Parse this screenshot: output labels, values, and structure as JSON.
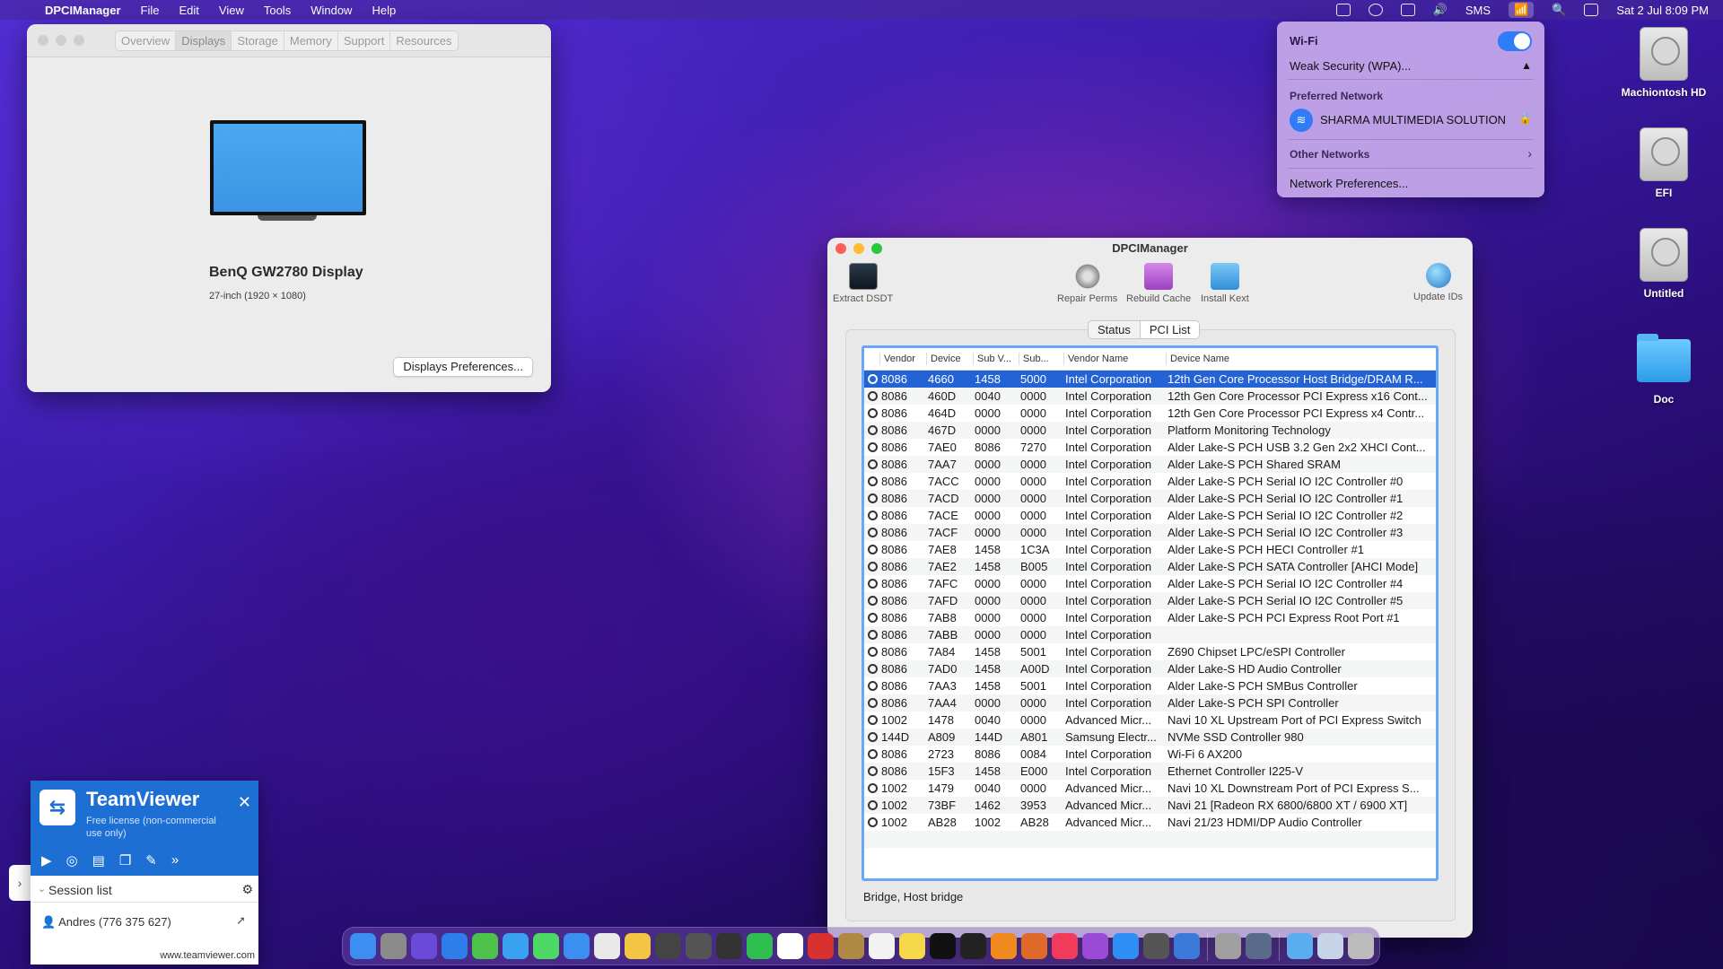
{
  "menubar": {
    "app": "DPCIManager",
    "items": [
      "File",
      "Edit",
      "View",
      "Tools",
      "Window",
      "Help"
    ],
    "sms": "SMS",
    "datetime": "Sat 2 Jul  8:09 PM"
  },
  "about": {
    "tabs": [
      "Overview",
      "Displays",
      "Storage",
      "Memory",
      "Support",
      "Resources"
    ],
    "display_name": "BenQ GW2780 Display",
    "display_sub": "27-inch (1920 × 1080)",
    "prefs_button": "Displays Preferences..."
  },
  "wifi_menu": {
    "title": "Wi-Fi",
    "weak": "Weak Security (WPA)...",
    "preferred_header": "Preferred Network",
    "network": "SHARMA MULTIMEDIA SOLUTION",
    "other": "Other Networks",
    "prefs": "Network Preferences..."
  },
  "desktop": [
    {
      "label": "Machiontosh HD",
      "icon": "hdd-icon"
    },
    {
      "label": "EFI",
      "icon": "hdd-icon"
    },
    {
      "label": "Untitled",
      "icon": "hdd-icon"
    },
    {
      "label": "Doc",
      "icon": "folder-icon"
    }
  ],
  "dpci": {
    "title": "DPCIManager",
    "tools": {
      "extract": "Extract DSDT",
      "repair": "Repair Perms",
      "rebuild": "Rebuild Cache",
      "install": "Install Kext",
      "update": "Update IDs"
    },
    "segments": [
      "Status",
      "PCI List"
    ],
    "columns": [
      "Vendor",
      "Device",
      "Sub V...",
      "Sub...",
      "Vendor Name",
      "Device Name"
    ],
    "rows": [
      [
        "8086",
        "4660",
        "1458",
        "5000",
        "Intel Corporation",
        "12th Gen Core Processor Host Bridge/DRAM R..."
      ],
      [
        "8086",
        "460D",
        "0040",
        "0000",
        "Intel Corporation",
        "12th Gen Core Processor PCI Express x16 Cont..."
      ],
      [
        "8086",
        "464D",
        "0000",
        "0000",
        "Intel Corporation",
        "12th Gen Core Processor PCI Express x4 Contr..."
      ],
      [
        "8086",
        "467D",
        "0000",
        "0000",
        "Intel Corporation",
        "Platform Monitoring Technology"
      ],
      [
        "8086",
        "7AE0",
        "8086",
        "7270",
        "Intel Corporation",
        "Alder Lake-S PCH USB 3.2 Gen 2x2 XHCI Cont..."
      ],
      [
        "8086",
        "7AA7",
        "0000",
        "0000",
        "Intel Corporation",
        "Alder Lake-S PCH Shared SRAM"
      ],
      [
        "8086",
        "7ACC",
        "0000",
        "0000",
        "Intel Corporation",
        "Alder Lake-S PCH Serial IO I2C Controller #0"
      ],
      [
        "8086",
        "7ACD",
        "0000",
        "0000",
        "Intel Corporation",
        "Alder Lake-S PCH Serial IO I2C Controller #1"
      ],
      [
        "8086",
        "7ACE",
        "0000",
        "0000",
        "Intel Corporation",
        "Alder Lake-S PCH Serial IO I2C Controller #2"
      ],
      [
        "8086",
        "7ACF",
        "0000",
        "0000",
        "Intel Corporation",
        "Alder Lake-S PCH Serial IO I2C Controller #3"
      ],
      [
        "8086",
        "7AE8",
        "1458",
        "1C3A",
        "Intel Corporation",
        "Alder Lake-S PCH HECI Controller #1"
      ],
      [
        "8086",
        "7AE2",
        "1458",
        "B005",
        "Intel Corporation",
        "Alder Lake-S PCH SATA Controller [AHCI Mode]"
      ],
      [
        "8086",
        "7AFC",
        "0000",
        "0000",
        "Intel Corporation",
        "Alder Lake-S PCH Serial IO I2C Controller #4"
      ],
      [
        "8086",
        "7AFD",
        "0000",
        "0000",
        "Intel Corporation",
        "Alder Lake-S PCH Serial IO I2C Controller #5"
      ],
      [
        "8086",
        "7AB8",
        "0000",
        "0000",
        "Intel Corporation",
        "Alder Lake-S PCH PCI Express Root Port #1"
      ],
      [
        "8086",
        "7ABB",
        "0000",
        "0000",
        "Intel Corporation",
        ""
      ],
      [
        "8086",
        "7A84",
        "1458",
        "5001",
        "Intel Corporation",
        "Z690 Chipset LPC/eSPI Controller"
      ],
      [
        "8086",
        "7AD0",
        "1458",
        "A00D",
        "Intel Corporation",
        "Alder Lake-S HD Audio Controller"
      ],
      [
        "8086",
        "7AA3",
        "1458",
        "5001",
        "Intel Corporation",
        "Alder Lake-S PCH SMBus Controller"
      ],
      [
        "8086",
        "7AA4",
        "0000",
        "0000",
        "Intel Corporation",
        "Alder Lake-S PCH SPI Controller"
      ],
      [
        "1002",
        "1478",
        "0040",
        "0000",
        "Advanced Micr...",
        "Navi 10 XL Upstream Port of PCI Express Switch"
      ],
      [
        "144D",
        "A809",
        "144D",
        "A801",
        "Samsung Electr...",
        "NVMe SSD Controller 980"
      ],
      [
        "8086",
        "2723",
        "8086",
        "0084",
        "Intel Corporation",
        "Wi-Fi 6 AX200"
      ],
      [
        "8086",
        "15F3",
        "1458",
        "E000",
        "Intel Corporation",
        "Ethernet Controller I225-V"
      ],
      [
        "1002",
        "1479",
        "0040",
        "0000",
        "Advanced Micr...",
        "Navi 10 XL Downstream Port of PCI Express S..."
      ],
      [
        "1002",
        "73BF",
        "1462",
        "3953",
        "Advanced Micr...",
        "Navi 21 [Radeon RX 6800/6800 XT / 6900 XT]"
      ],
      [
        "1002",
        "AB28",
        "1002",
        "AB28",
        "Advanced Micr...",
        "Navi 21/23 HDMI/DP Audio Controller"
      ]
    ],
    "status_line": "Bridge, Host bridge"
  },
  "teamviewer": {
    "name": "TeamViewer",
    "license": "Free license (non-commercial use only)",
    "session_list": "Session list",
    "user": "Andres (776 375 627)",
    "url": "www.teamviewer.com"
  },
  "dock_colors": [
    "#3c8ef0",
    "#8a8a8a",
    "#6a4bd8",
    "#2d7ee8",
    "#4cc24a",
    "#3aa0f0",
    "#4cd964",
    "#3b8ff0",
    "#e9e9e9",
    "#f4c542",
    "#444444",
    "#555555",
    "#333333",
    "#2fbf4f",
    "#ffffff",
    "#d93030",
    "#b08a45",
    "#f2f2f2",
    "#f7d84a",
    "#111111",
    "#222222",
    "#f08a1c",
    "#e06a2a",
    "#f23b5a",
    "#9b4ad8",
    "#2f8ef4",
    "#555555",
    "#3b7ad8",
    "#a0a0a0",
    "#5a6a8a",
    "#5aaef0",
    "#c8d4e8",
    "#bcbcbc"
  ]
}
